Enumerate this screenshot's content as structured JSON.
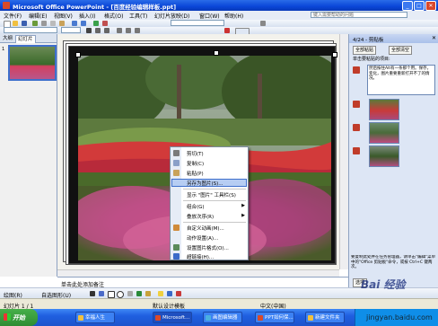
{
  "window": {
    "title": "Microsoft Office PowerPoint - [百度经验编辑样板.ppt]"
  },
  "menubar": {
    "items": [
      "文件(F)",
      "编辑(E)",
      "视图(V)",
      "插入(I)",
      "格式(O)",
      "工具(T)",
      "幻灯片放映(D)",
      "窗口(W)",
      "帮助(H)"
    ],
    "help_placeholder": "键入需要帮助的问题"
  },
  "outline_tabs": [
    "大纲",
    "幻灯片"
  ],
  "slide_panel": {
    "thumb_number": "1"
  },
  "notes_placeholder": "单击此处添加备注",
  "context_menu": {
    "items": [
      {
        "label": "剪切(T)",
        "icon": "scissors-icon"
      },
      {
        "label": "复制(C)",
        "icon": "copy-icon"
      },
      {
        "label": "粘贴(P)",
        "icon": "paste-icon"
      },
      {
        "label": "另存为图片(S)...",
        "selected": true
      },
      {
        "label": "显示 \"图片\" 工具栏(S)"
      },
      {
        "label": "组合(G)",
        "submenu": true
      },
      {
        "label": "叠放次序(R)",
        "submenu": true
      },
      {
        "label": "自定义动画(M)...",
        "icon": "animation-icon"
      },
      {
        "label": "动作设置(A)..."
      },
      {
        "label": "设置图片格式(O)...",
        "icon": "format-icon"
      },
      {
        "label": "超链接(H)...",
        "icon": "hyperlink-icon"
      }
    ]
  },
  "taskpane": {
    "header": "4/24 - 剪贴板",
    "paste_all": "全部粘贴",
    "clear_all": "全部清空",
    "instruction": "单击要粘贴的项目:",
    "item1_text": "然后按住Alt有一条那个用。保存，变化，图片重要重新打开不了的情况。",
    "options_label": "选项",
    "footer_text": "要复制此处并在任务管理器，请单击\"编辑\"菜单中的\"Office 剪贴板\"命令，或按 Ctrl+C 键两次。"
  },
  "drawing_toolbar": {
    "draw_label": "绘图(R)",
    "autoshapes_label": "自选图形(U)"
  },
  "statusbar": {
    "slide_info": "幻灯片 1 / 1",
    "design": "默认设计模板",
    "language": "中文(中国)"
  },
  "taskbar": {
    "start_label": "开始",
    "buttons": [
      "幸福人生",
      "Microsoft...",
      "画图编辑器",
      "PPT如何保...",
      "新建文件夹"
    ]
  },
  "watermark": {
    "brand": "Bai 经验",
    "site": "jingyan.baidu.com"
  },
  "colors": {
    "title_bar": "#0a46d8",
    "selection": "#b6cdf3",
    "taskbar": "#1f5fe0",
    "start_button": "#3c9a3f"
  }
}
